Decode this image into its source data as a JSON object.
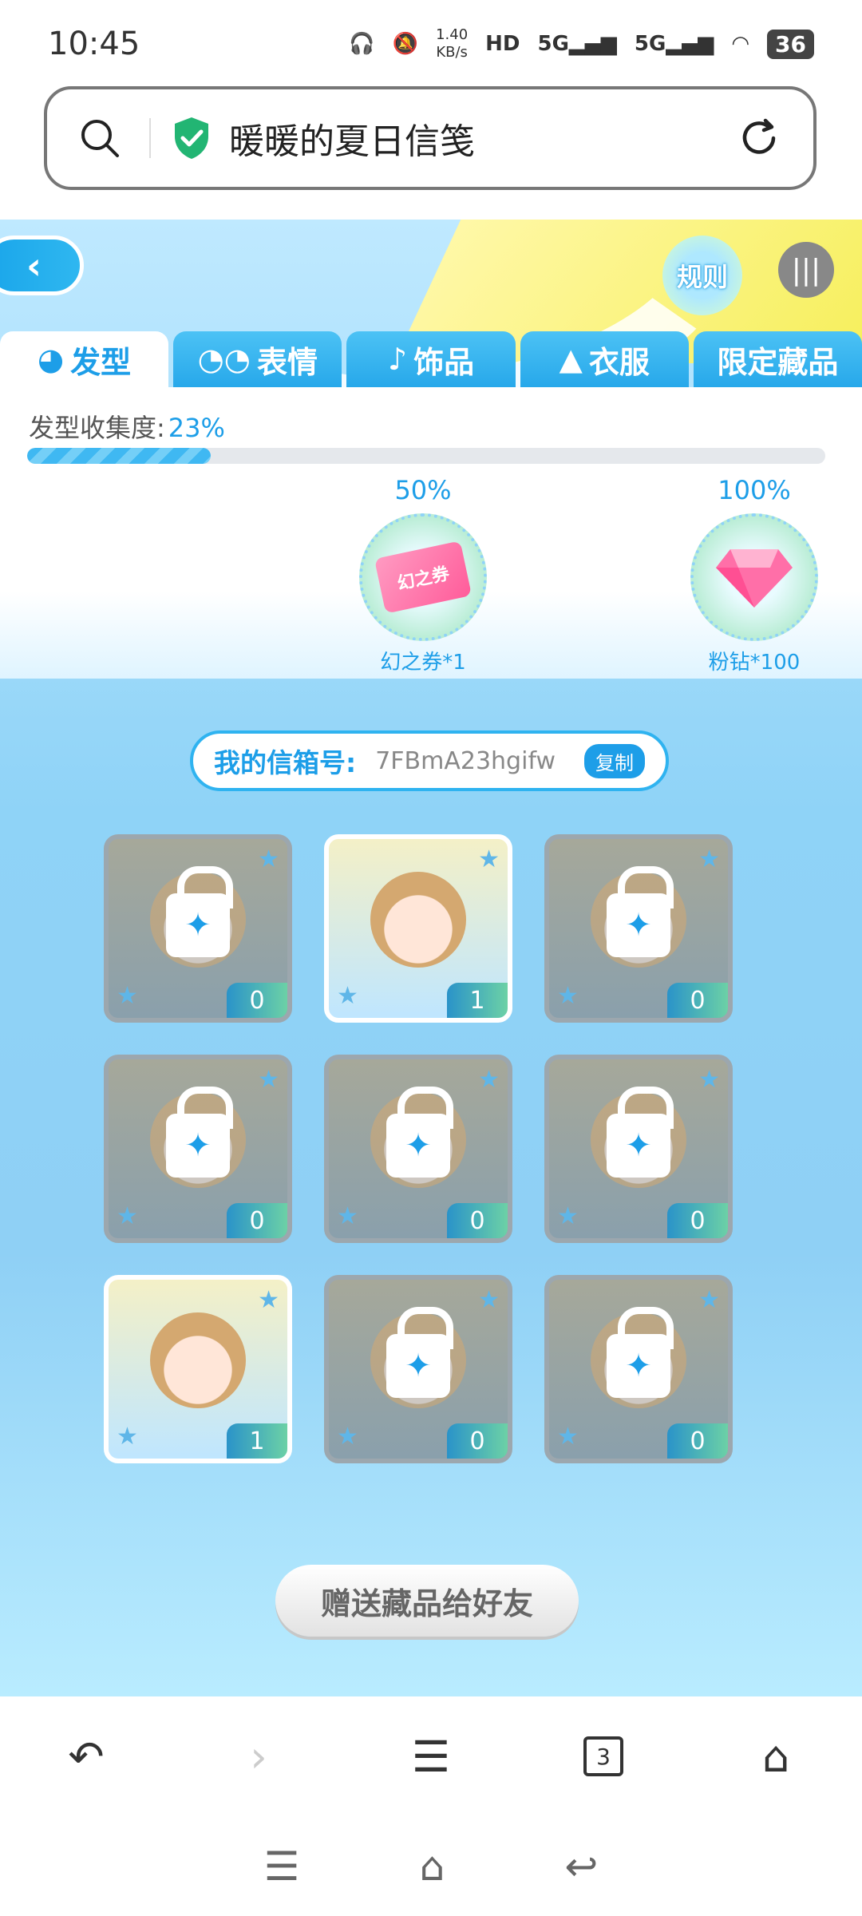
{
  "status": {
    "time": "10:45",
    "net_speed_top": "1.40",
    "net_speed_bottom": "KB/s",
    "battery": "36"
  },
  "url": {
    "title": "暖暖的夏日信笺"
  },
  "game": {
    "rules_label": "规则",
    "tabs": [
      {
        "label": "发型",
        "icon": "hair-icon",
        "active": true
      },
      {
        "label": "表情",
        "icon": "mask-icon",
        "active": false
      },
      {
        "label": "饰品",
        "icon": "accessory-icon",
        "active": false
      },
      {
        "label": "衣服",
        "icon": "clothes-icon",
        "active": false
      },
      {
        "label": "限定藏品",
        "icon": "",
        "active": false
      }
    ],
    "collection": {
      "label": "发型收集度:",
      "percent": "23%",
      "progress": 0.23
    },
    "rewards": [
      {
        "threshold": "50%",
        "label": "幻之券*1",
        "ticket_text": "幻之券"
      },
      {
        "threshold": "100%",
        "label": "粉钻*100"
      }
    ],
    "mailbox": {
      "label": "我的信箱号:",
      "code": "7FBmA23hgifw",
      "copy_label": "复制"
    },
    "items": [
      {
        "count": "0",
        "locked": true
      },
      {
        "count": "1",
        "locked": false
      },
      {
        "count": "0",
        "locked": true
      },
      {
        "count": "0",
        "locked": true
      },
      {
        "count": "0",
        "locked": true
      },
      {
        "count": "0",
        "locked": true
      },
      {
        "count": "1",
        "locked": false
      },
      {
        "count": "0",
        "locked": true
      },
      {
        "count": "0",
        "locked": true
      }
    ],
    "gift_label": "赠送藏品给好友"
  },
  "browser_nav": {
    "tab_count": "3"
  }
}
